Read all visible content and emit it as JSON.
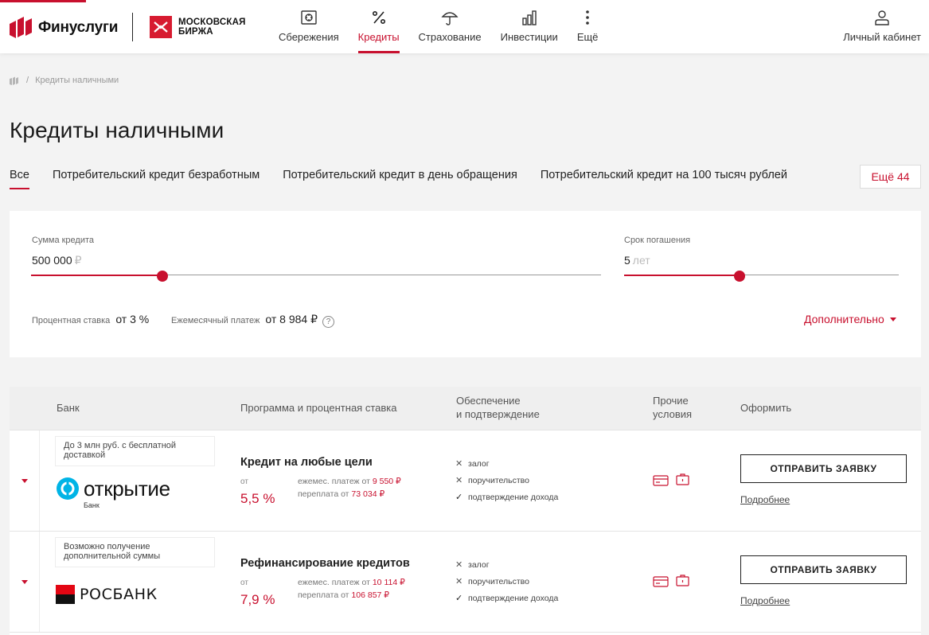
{
  "header": {
    "brand_name": "Финуслуги",
    "partner_line1": "МОСКОВСКАЯ",
    "partner_line2": "БИРЖА",
    "nav": [
      {
        "label": "Сбережения",
        "icon": "safe-icon"
      },
      {
        "label": "Кредиты",
        "icon": "percent-icon",
        "active": true
      },
      {
        "label": "Страхование",
        "icon": "umbrella-icon"
      },
      {
        "label": "Инвестиции",
        "icon": "bar-chart-icon"
      },
      {
        "label": "Ещё",
        "icon": "more-vertical-icon"
      }
    ],
    "account_label": "Личный кабинет",
    "colors": {
      "accent": "#c8102e",
      "partner": "#d71b30"
    }
  },
  "breadcrumb": {
    "current": "Кредиты наличными"
  },
  "page_title": "Кредиты наличными",
  "tabs": [
    {
      "label": "Все",
      "active": true
    },
    {
      "label": "Потребительский кредит безработным"
    },
    {
      "label": "Потребительский кредит в день обращения"
    },
    {
      "label": "Потребительский кредит на 100 тысяч рублей"
    }
  ],
  "more_tabs_label": "Ещё 44",
  "calculator": {
    "amount": {
      "label": "Сумма кредита",
      "value": "500 000",
      "unit": "₽",
      "slider_position": 0.23
    },
    "term": {
      "label": "Срок погашения",
      "value": "5",
      "unit": "лет",
      "slider_position": 0.42
    },
    "rate_label": "Процентная ставка",
    "rate_value": "от 3 %",
    "payment_label": "Ежемесячный платеж",
    "payment_value": "от 8 984 ₽",
    "help": "?",
    "additional_label": "Дополнительно"
  },
  "table": {
    "headers": {
      "bank": "Банк",
      "program": "Программа и процентная ставка",
      "security_line1": "Обеспечение",
      "security_line2": "и подтверждение",
      "other_line1": "Прочие",
      "other_line2": "условия",
      "apply": "Оформить"
    },
    "rows": [
      {
        "promo": "До 3 млн руб. с бесплатной доставкой",
        "bank_name": "открытие",
        "bank_sub": "Банк",
        "program": "Кредит на любые цели",
        "from_label": "от",
        "rate": "5,5 %",
        "payment_label": "ежемес. платеж от",
        "payment_value": "9 550 ₽",
        "overpay_label": "переплата от",
        "overpay_value": "73 034 ₽",
        "conditions": [
          {
            "text": "залог",
            "ok": false
          },
          {
            "text": "поручительство",
            "ok": false
          },
          {
            "text": "подтверждение дохода",
            "ok": true
          }
        ],
        "apply_label": "ОТПРАВИТЬ ЗАЯВКУ",
        "details_label": "Подробнее"
      },
      {
        "promo": "Возможно получение дополнительной суммы",
        "bank_name": "РОСБАНК",
        "program": "Рефинансирование кредитов",
        "from_label": "от",
        "rate": "7,9 %",
        "payment_label": "ежемес. платеж от",
        "payment_value": "10 114 ₽",
        "overpay_label": "переплата от",
        "overpay_value": "106 857 ₽",
        "conditions": [
          {
            "text": "залог",
            "ok": false
          },
          {
            "text": "поручительство",
            "ok": false
          },
          {
            "text": "подтверждение дохода",
            "ok": true
          }
        ],
        "apply_label": "ОТПРАВИТЬ ЗАЯВКУ",
        "details_label": "Подробнее"
      }
    ]
  }
}
